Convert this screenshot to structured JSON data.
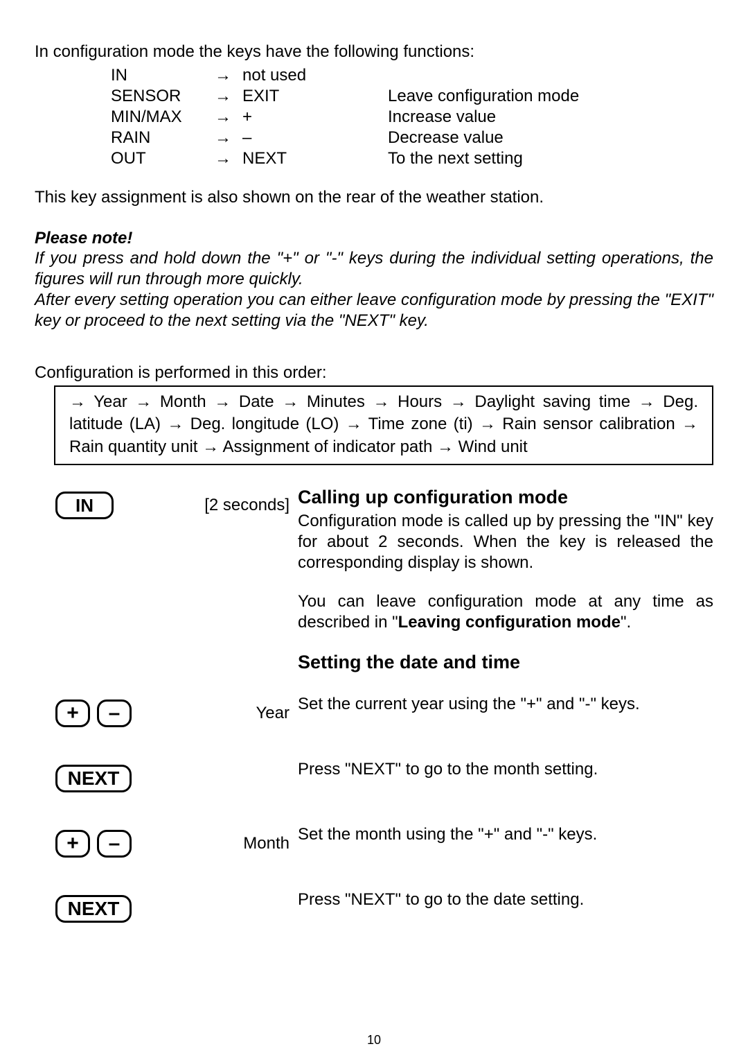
{
  "intro": "In configuration mode the keys have the following functions:",
  "key_functions": [
    {
      "key": "IN",
      "func": "not used",
      "desc": ""
    },
    {
      "key": "SENSOR",
      "func": "EXIT",
      "desc": "Leave configuration mode"
    },
    {
      "key": "MIN/MAX",
      "func": "+",
      "desc": "Increase value"
    },
    {
      "key": "RAIN",
      "func": "–",
      "desc": "Decrease value"
    },
    {
      "key": "OUT",
      "func": "NEXT",
      "desc": "To the next setting"
    }
  ],
  "rear_note": "This key assignment is also shown on the rear of the weather station.",
  "please_note_title": "Please note!",
  "please_note_body1": "If you press and hold down the \"+\" or \"-\" keys during the individual setting operations, the figures will run through more quickly.",
  "please_note_body2": "After every setting operation you can either leave configuration mode by pressing the \"EXIT\" key or proceed to the next setting via the \"NEXT\" key.",
  "config_order_title": "Configuration is performed in this order:",
  "flow_sequence": "→ Year → Month → Date → Minutes → Hours → Daylight saving time → Deg. latitude (LA) → Deg. longitude (LO) → Time zone (ti) →  Rain sensor calibration → Rain quantity unit → Assignment of indicator path → Wind unit",
  "steps": {
    "calling": {
      "key": "IN",
      "label": "[2 seconds]",
      "heading": "Calling up configuration mode",
      "body1": "Configuration mode is called up by pressing the \"IN\" key for about 2 seconds. When the key is released the corresponding display is shown.",
      "body2_pre": "You can leave configuration mode at any time as described in \"",
      "body2_bold": "Leaving configuration mode",
      "body2_post": "\"."
    },
    "datetime_heading": "Setting the date and time",
    "year": {
      "plus": "+",
      "minus": "–",
      "label": "Year",
      "body": "Set the current year using the \"+\" and \"-\" keys."
    },
    "next1": {
      "key": "NEXT",
      "body": "Press \"NEXT\" to go to the month setting."
    },
    "month": {
      "plus": "+",
      "minus": "–",
      "label": "Month",
      "body": "Set the month using the \"+\" and \"-\" keys."
    },
    "next2": {
      "key": "NEXT",
      "body": "Press \"NEXT\" to go to the date setting."
    }
  },
  "page_number": "10"
}
